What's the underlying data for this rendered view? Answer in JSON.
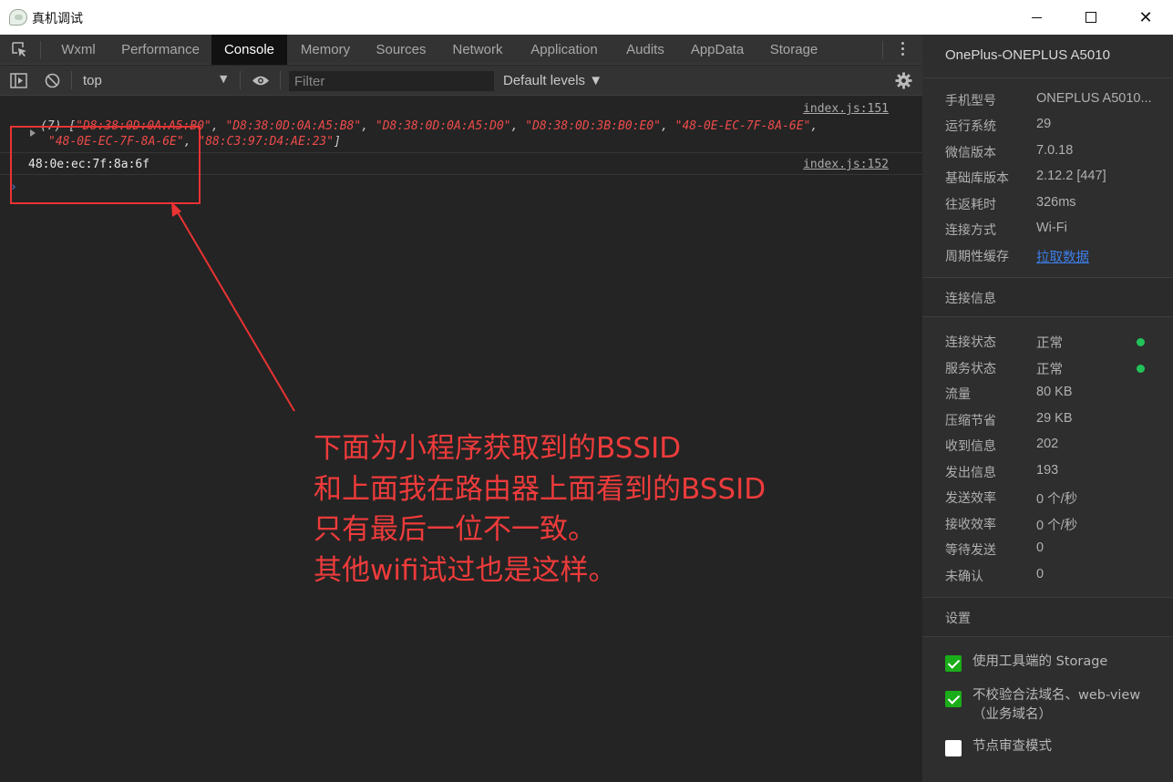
{
  "window": {
    "title": "真机调试"
  },
  "tabs": [
    {
      "label": "Wxml"
    },
    {
      "label": "Performance"
    },
    {
      "label": "Console",
      "active": true
    },
    {
      "label": "Memory"
    },
    {
      "label": "Sources"
    },
    {
      "label": "Network"
    },
    {
      "label": "Application"
    },
    {
      "label": "Audits"
    },
    {
      "label": "AppData"
    },
    {
      "label": "Storage"
    }
  ],
  "toolbar": {
    "context": "top",
    "filter_placeholder": "Filter",
    "levels": "Default levels ▼"
  },
  "console": {
    "entry1": {
      "count": "(7) [",
      "items": [
        "\"D8:38:0D:0A:A5:B0\"",
        "\"D8:38:0D:0A:A5:B8\"",
        "\"D8:38:0D:0A:A5:D0\"",
        "\"D8:38:0D:3B:B0:E0\"",
        "\"48-0E-EC-7F-8A-6E\"",
        "\"48-0E-EC-7F-8A-6E\"",
        "\"88:C3:97:D4:AE:23\""
      ],
      "close": "]",
      "source": "index.js:151"
    },
    "entry2": {
      "text": "48:0e:ec:7f:8a:6f",
      "source": "index.js:152"
    },
    "prompt": "›"
  },
  "annotation": {
    "lines": [
      "下面为小程序获取到的BSSID",
      "和上面我在路由器上面看到的BSSID",
      "只有最后一位不一致。",
      "其他wifi试过也是这样。"
    ],
    "color": "#ee3b3b"
  },
  "panel": {
    "device": "OnePlus-ONEPLUS A5010",
    "info": [
      {
        "k": "手机型号",
        "v": "ONEPLUS A5010..."
      },
      {
        "k": "运行系统",
        "v": "29"
      },
      {
        "k": "微信版本",
        "v": "7.0.18"
      },
      {
        "k": "基础库版本",
        "v": "2.12.2 [447]"
      },
      {
        "k": "往返耗时",
        "v": "326ms"
      },
      {
        "k": "连接方式",
        "v": "Wi-Fi"
      },
      {
        "k": "周期性缓存",
        "v": "拉取数据"
      }
    ],
    "conn_title": "连接信息",
    "conn": [
      {
        "k": "连接状态",
        "v": "正常"
      },
      {
        "k": "服务状态",
        "v": "正常"
      },
      {
        "k": "流量",
        "v": "80 KB"
      },
      {
        "k": "压缩节省",
        "v": "29 KB"
      },
      {
        "k": "收到信息",
        "v": "202"
      },
      {
        "k": "发出信息",
        "v": "193"
      },
      {
        "k": "发送效率",
        "v": "0 个/秒"
      },
      {
        "k": "接收效率",
        "v": "0 个/秒"
      },
      {
        "k": "等待发送",
        "v": "0"
      },
      {
        "k": "未确认",
        "v": "0"
      }
    ],
    "settings_title": "设置",
    "settings": [
      {
        "label": "使用工具端的 Storage",
        "checked": true
      },
      {
        "label": "不校验合法域名、web-view（业务域名）",
        "checked": true
      },
      {
        "label": "节点审查模式",
        "checked": false
      }
    ]
  },
  "colors": {
    "accent_green": "#1aad19",
    "status_dot": "#21c25a",
    "link": "#3d7ee8",
    "string_red": "#ee4b4b"
  }
}
